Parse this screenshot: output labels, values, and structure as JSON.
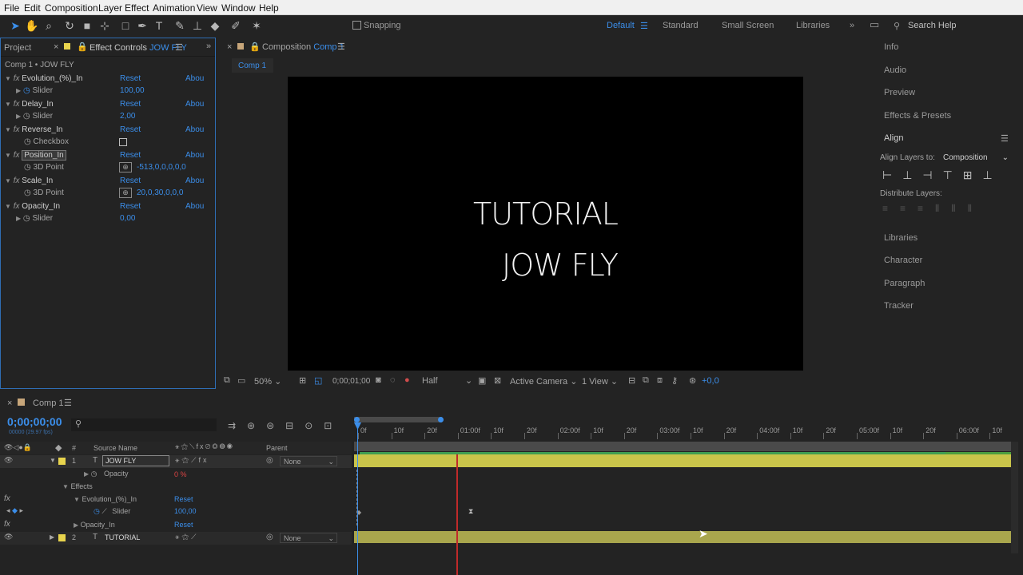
{
  "menu": [
    "File",
    "Edit",
    "Composition",
    "Layer",
    "Effect",
    "Animation",
    "View",
    "Window",
    "Help"
  ],
  "toolbar": {
    "snapping_label": "Snapping",
    "workspaces": [
      "Default",
      "Standard",
      "Small Screen",
      "Libraries"
    ],
    "search_placeholder": "Search Help"
  },
  "project_panel": {
    "tab_project": "Project",
    "tab_effect_controls": "Effect Controls",
    "layer_name": "JOW FLY",
    "header": "Comp 1 • JOW FLY"
  },
  "effects": [
    {
      "name": "Evolution_(%)_In",
      "reset": "Reset",
      "about": "Abou",
      "param": "Slider",
      "value": "100,00"
    },
    {
      "name": "Delay_In",
      "reset": "Reset",
      "about": "Abou",
      "param": "Slider",
      "value": "2,00"
    },
    {
      "name": "Reverse_In",
      "reset": "Reset",
      "about": "Abou",
      "param": "Checkbox",
      "value": ""
    },
    {
      "name": "Position_In",
      "reset": "Reset",
      "about": "Abou",
      "param": "3D Point",
      "value": "-513,0,0,0,0,0"
    },
    {
      "name": "Scale_In",
      "reset": "Reset",
      "about": "Abou",
      "param": "3D Point",
      "value": "20,0,30,0,0,0"
    },
    {
      "name": "Opacity_In",
      "reset": "Reset",
      "about": "Abou",
      "param": "Slider",
      "value": "0,00"
    }
  ],
  "composition": {
    "tab_prefix": "Composition",
    "tab_name": "Comp 1",
    "sub_tab": "Comp 1",
    "text_line1": "TUTORIAL",
    "text_line2": "JOW FLY",
    "zoom": "50%",
    "timecode": "0;00;01;00",
    "resolution": "Half",
    "camera": "Active Camera",
    "view": "1 View",
    "exposure": "+0,0"
  },
  "right_panel": {
    "items_top": [
      "Info",
      "Audio",
      "Preview",
      "Effects & Presets"
    ],
    "align_title": "Align",
    "align_layers_label": "Align Layers to:",
    "align_layers_value": "Composition",
    "distribute_label": "Distribute Layers:",
    "items_bottom": [
      "Libraries",
      "Character",
      "Paragraph",
      "Tracker"
    ]
  },
  "timeline": {
    "tab": "Comp 1",
    "timecode": "0;00;00;00",
    "fps": "00000 (29.97 fps)",
    "col_source": "Source Name",
    "col_parent": "Parent",
    "ticks": [
      "0f",
      "10f",
      "20f",
      "01:00f",
      "10f",
      "20f",
      "02:00f",
      "10f",
      "20f",
      "03:00f",
      "10f",
      "20f",
      "04:00f",
      "10f",
      "20f",
      "05:00f",
      "10f",
      "20f",
      "06:00f",
      "10f"
    ],
    "layers": [
      {
        "num": "1",
        "name": "JOW FLY",
        "parent": "None"
      },
      {
        "num": "2",
        "name": "TUTORIAL",
        "parent": "None"
      }
    ],
    "opacity_label": "Opacity",
    "opacity_value": "0 %",
    "effects_label": "Effects",
    "evo_label": "Evolution_(%)_In",
    "evo_reset": "Reset",
    "slider_label": "Slider",
    "slider_value": "100,00",
    "opacity_in_label": "Opacity_In",
    "opacity_in_reset": "Reset"
  }
}
